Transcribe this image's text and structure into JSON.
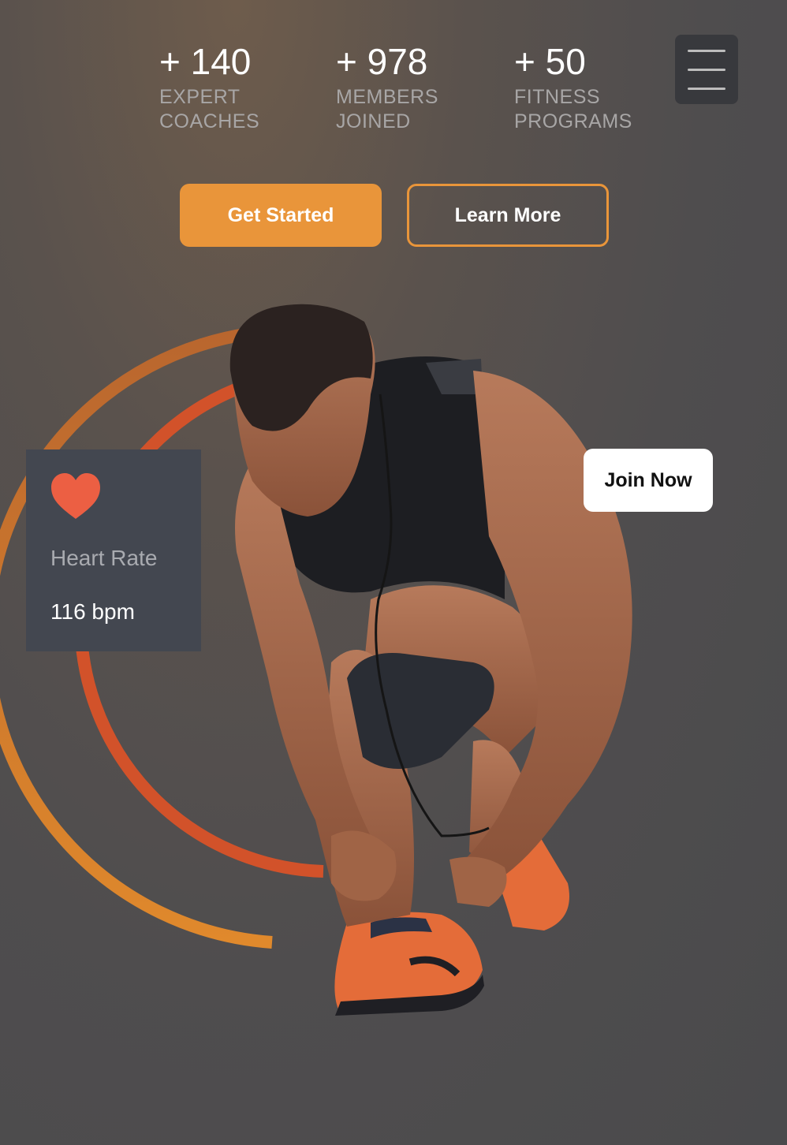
{
  "stats": [
    {
      "value": "+ 140",
      "label_line1": "EXPERT",
      "label_line2": "COACHES"
    },
    {
      "value": "+ 978",
      "label_line1": "MEMBERS",
      "label_line2": "JOINED"
    },
    {
      "value": "+ 50",
      "label_line1": "FITNESS",
      "label_line2": "PROGRAMS"
    }
  ],
  "menu": {
    "icon": "hamburger-menu-icon"
  },
  "actions": {
    "get_started": "Get Started",
    "learn_more": "Learn More"
  },
  "heart_card": {
    "icon": "heart-icon",
    "label": "Heart Rate",
    "value": "116 bpm"
  },
  "join": {
    "label": "Join Now"
  },
  "colors": {
    "accent": "#e9953a",
    "heart": "#ec5f43",
    "card": "#434750",
    "arc_outer": "#d9822a",
    "arc_inner": "#d2522a"
  }
}
